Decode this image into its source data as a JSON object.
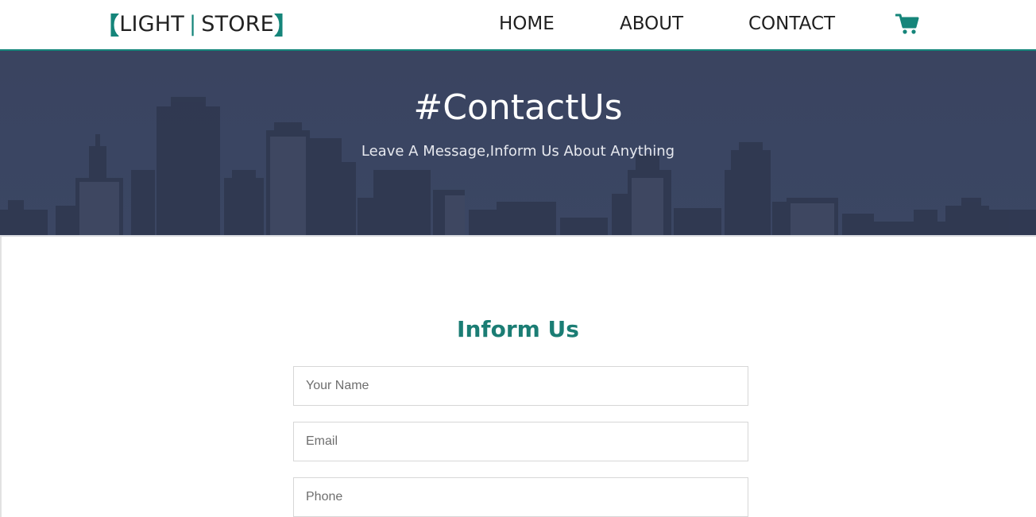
{
  "navbar": {
    "logo": {
      "open": "【",
      "part1": "LIGHT",
      "sep": "|",
      "part2": "STORE",
      "close": "】"
    },
    "links": [
      "HOME",
      "ABOUT",
      "CONTACT"
    ],
    "cart_icon": "shopping-cart-icon"
  },
  "hero": {
    "title": "#ContactUs",
    "subtitle": "Leave A Message,Inform Us About Anything"
  },
  "form": {
    "title": "Inform Us",
    "fields": [
      {
        "placeholder": "Your Name",
        "value": ""
      },
      {
        "placeholder": "Email",
        "value": ""
      },
      {
        "placeholder": "Phone",
        "value": ""
      }
    ]
  },
  "colors": {
    "accent": "#15857a",
    "hero_bg": "#3a4460",
    "form_title": "#1b7d74"
  }
}
